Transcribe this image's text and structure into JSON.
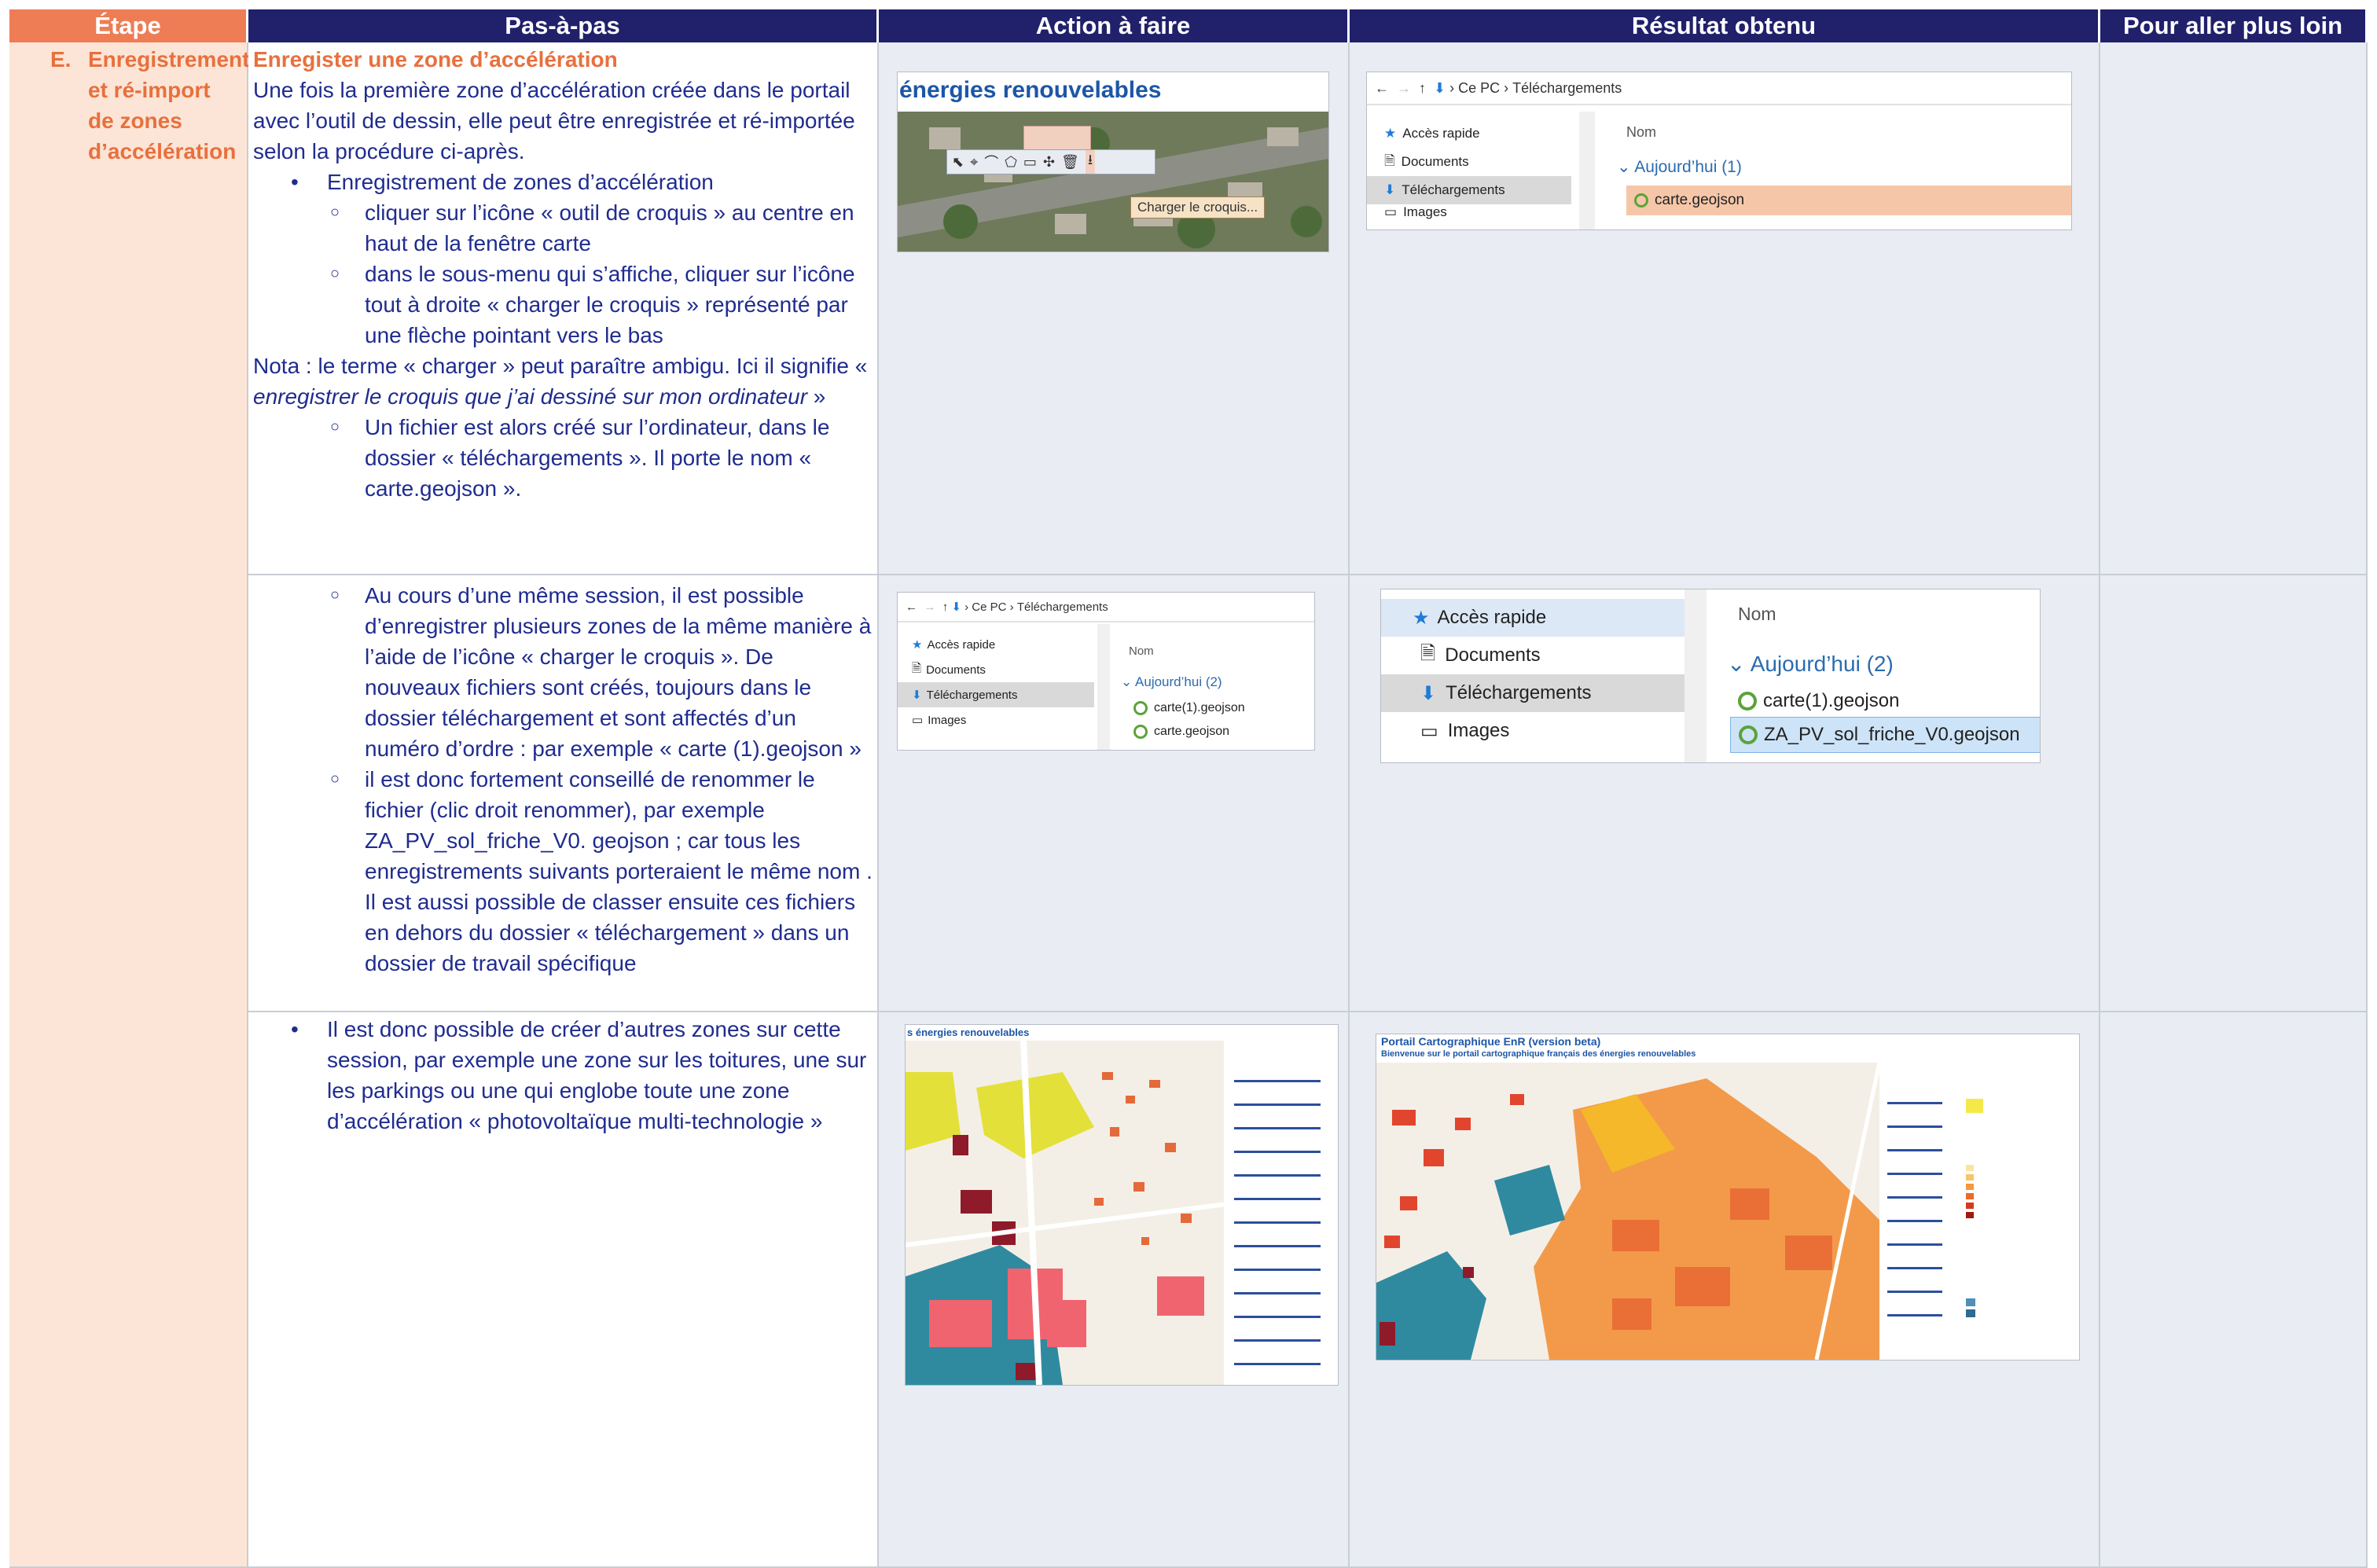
{
  "headers": [
    "Étape",
    "Pas-à-pas",
    "Action à faire",
    "Résultat obtenu",
    "Pour aller plus loin"
  ],
  "etape": {
    "letter": "E.",
    "label": "Enregistrement et ré-import de zones d’accélération"
  },
  "row1": {
    "title": "Enregister une zone d’accélération",
    "intro": "Une fois la première zone d’accélération créée dans le portail avec l’outil de dessin, elle peut être enregistrée et ré-importée selon la procédure ci-après.",
    "bullet": "Enregistrement de zones d’accélération",
    "sub1": "cliquer sur l’icône « outil de croquis » au centre en haut de la fenêtre carte",
    "sub2": "dans le sous-menu qui s’affiche, cliquer sur l’icône tout à droite « charger le croquis » représenté par une flèche pointant vers le bas",
    "nota_a": "Nota : le terme « charger » peut paraître ambigu. Ici il signifie « ",
    "nota_em": "enregistrer le croquis que j’ai dessiné sur mon ordinateur",
    "nota_b": " »",
    "sub3": "Un fichier est alors créé sur l’ordinateur, dans le dossier « téléchargements ». Il porte le nom « carte.geojson »."
  },
  "row2": {
    "sub1": "Au cours d’une même session, il est possible d’enregistrer plusieurs zones de la même manière à l’aide de l’icône « charger le croquis ». De nouveaux fichiers sont créés, toujours dans le dossier téléchargement et sont affectés d’un numéro d’ordre : par exemple « carte (1).geojson »",
    "sub2": "il est donc fortement conseillé de renommer le fichier (clic droit renommer), par exemple ZA_PV_sol_friche_V0. geojson ; car tous les enregistrements suivants porteraient le même nom . Il est aussi possible de classer ensuite ces fichiers en dehors du dossier « téléchargement » dans un dossier de travail spécifique"
  },
  "row3": {
    "bullet": "Il est donc possible de créer d’autres zones sur cette session, par exemple une zone sur les toitures, une sur les parkings ou une qui englobe toute une zone d’accélération « photovoltaïque multi-technologie »"
  },
  "shots": {
    "portal_title": "énergies renouvelables",
    "tooltip": "Charger le croquis...",
    "breadcrumb_pc": "Ce PC",
    "breadcrumb_dl": "Téléchargements",
    "acces_rapide": "Accès rapide",
    "documents": "Documents",
    "telechargements": "Téléchargements",
    "images": "Images",
    "nom": "Nom",
    "today1": "Aujourd’hui (1)",
    "today2": "Aujourd’hui (2)",
    "file1": "carte.geojson",
    "file2": "carte(1).geojson",
    "file3": "ZA_PV_sol_friche_V0.geojson",
    "map_title_left": "s énergies renouvelables",
    "portal2_title": "Portail Cartographique EnR (version beta)",
    "portal2_sub": "Bienvenue sur le portail cartographique français des énergies renouvelables"
  },
  "colors": {
    "header_bg": "#21206b",
    "etape_header": "#ee7d55",
    "etape_bg": "#fce5d6",
    "accent": "#e8703e",
    "text": "#1f2c8f",
    "cell_bg": "#e9ecf3"
  }
}
